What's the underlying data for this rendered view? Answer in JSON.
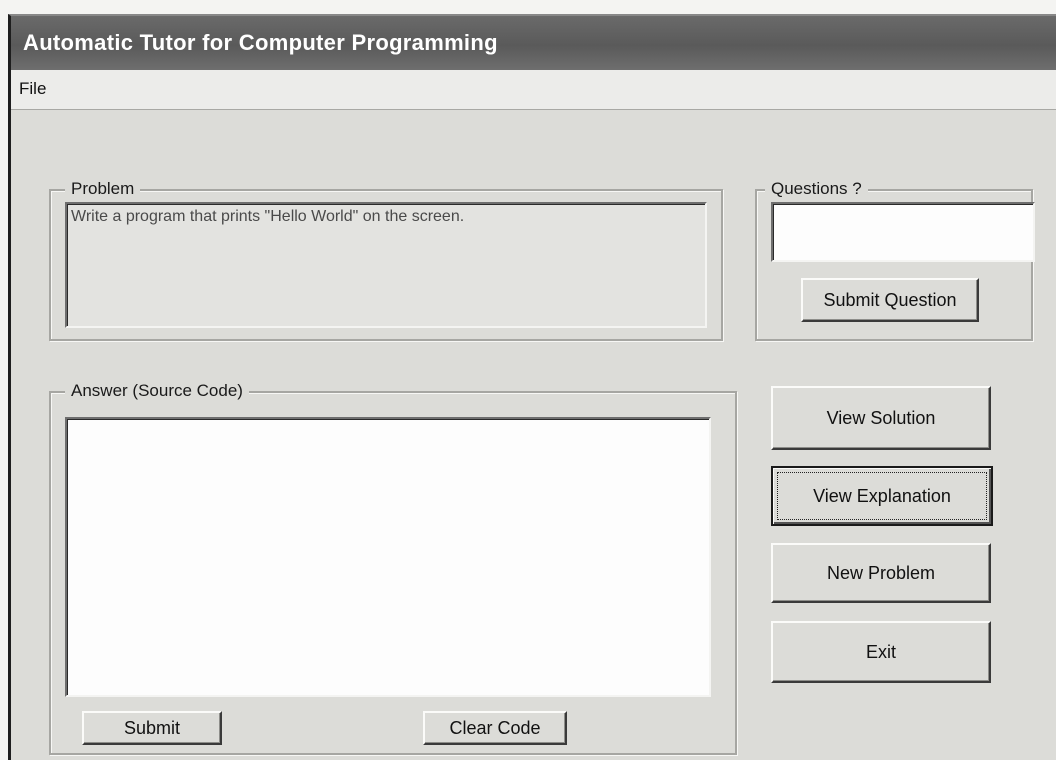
{
  "window": {
    "title": "Automatic Tutor for Computer Programming"
  },
  "menu": {
    "file_label": "File"
  },
  "problem": {
    "group_label": "Problem",
    "text": "Write a program that prints \"Hello World\" on the screen."
  },
  "questions": {
    "group_label": "Questions ?",
    "input_value": "",
    "submit_label": "Submit Question"
  },
  "answer": {
    "group_label": "Answer (Source Code)",
    "code_value": "",
    "submit_label": "Submit",
    "clear_label": "Clear Code"
  },
  "actions": {
    "view_solution_label": "View Solution",
    "view_explanation_label": "View Explanation",
    "new_problem_label": "New Problem",
    "exit_label": "Exit"
  }
}
